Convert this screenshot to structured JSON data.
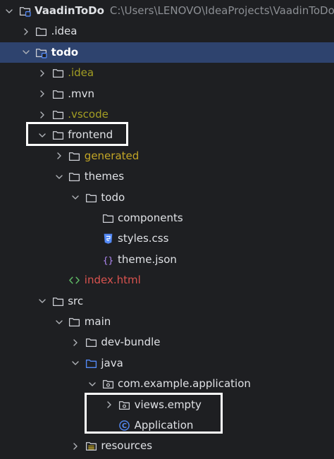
{
  "project": {
    "name": "VaadinToDo",
    "path": "C:\\Users\\LENOVO\\IdeaProjects\\VaadinToDo"
  },
  "colors": {
    "default_text": "#dfe1e5",
    "excluded_text": "#a39e23",
    "generated_text": "#c3a626",
    "error_text": "#d9534f",
    "selection_bg": "#2e436e",
    "folder_icon": "#ced0d6",
    "java_folder_icon": "#548af7"
  },
  "rows": [
    {
      "label": "VaadinToDo",
      "depth": 0,
      "arrow": "down",
      "icon": "module-folder-icon",
      "bold": true,
      "color": "#dfe1e5",
      "show_path": true
    },
    {
      "label": ".idea",
      "depth": 1,
      "arrow": "right",
      "icon": "folder-icon",
      "color": "#dfe1e5"
    },
    {
      "label": "todo",
      "depth": 1,
      "arrow": "down",
      "icon": "module-folder-icon",
      "bold": true,
      "color": "#ffffff",
      "selected": true
    },
    {
      "label": ".idea",
      "depth": 2,
      "arrow": "right",
      "icon": "folder-icon",
      "color": "#a39e23"
    },
    {
      "label": ".mvn",
      "depth": 2,
      "arrow": "right",
      "icon": "folder-icon",
      "color": "#dfe1e5"
    },
    {
      "label": ".vscode",
      "depth": 2,
      "arrow": "right",
      "icon": "folder-icon",
      "color": "#a39e23"
    },
    {
      "label": "frontend",
      "depth": 2,
      "arrow": "down",
      "icon": "folder-icon",
      "color": "#dfe1e5"
    },
    {
      "label": "generated",
      "depth": 3,
      "arrow": "right",
      "icon": "folder-icon",
      "color": "#c3a626"
    },
    {
      "label": "themes",
      "depth": 3,
      "arrow": "down",
      "icon": "folder-icon",
      "color": "#dfe1e5"
    },
    {
      "label": "todo",
      "depth": 4,
      "arrow": "down",
      "icon": "folder-icon",
      "color": "#dfe1e5"
    },
    {
      "label": "components",
      "depth": 5,
      "arrow": "none",
      "icon": "folder-icon",
      "color": "#dfe1e5"
    },
    {
      "label": "styles.css",
      "depth": 5,
      "arrow": "none",
      "icon": "css-file-icon",
      "color": "#dfe1e5"
    },
    {
      "label": "theme.json",
      "depth": 5,
      "arrow": "none",
      "icon": "json-file-icon",
      "color": "#dfe1e5"
    },
    {
      "label": "index.html",
      "depth": 3,
      "arrow": "none",
      "icon": "html-file-icon",
      "color": "#d9534f"
    },
    {
      "label": "src",
      "depth": 2,
      "arrow": "down",
      "icon": "folder-icon",
      "color": "#dfe1e5"
    },
    {
      "label": "main",
      "depth": 3,
      "arrow": "down",
      "icon": "folder-icon",
      "color": "#dfe1e5"
    },
    {
      "label": "dev-bundle",
      "depth": 4,
      "arrow": "right",
      "icon": "folder-icon",
      "color": "#dfe1e5"
    },
    {
      "label": "java",
      "depth": 4,
      "arrow": "down",
      "icon": "source-folder-icon",
      "color": "#dfe1e5"
    },
    {
      "label": "com.example.application",
      "depth": 5,
      "arrow": "down",
      "icon": "package-icon",
      "color": "#dfe1e5"
    },
    {
      "label": "views.empty",
      "depth": 6,
      "arrow": "right",
      "icon": "package-icon",
      "color": "#dfe1e5"
    },
    {
      "label": "Application",
      "depth": 6,
      "arrow": "none",
      "icon": "java-class-icon",
      "color": "#dfe1e5"
    },
    {
      "label": "resources",
      "depth": 4,
      "arrow": "right",
      "icon": "resources-folder-icon",
      "color": "#dfe1e5"
    }
  ]
}
